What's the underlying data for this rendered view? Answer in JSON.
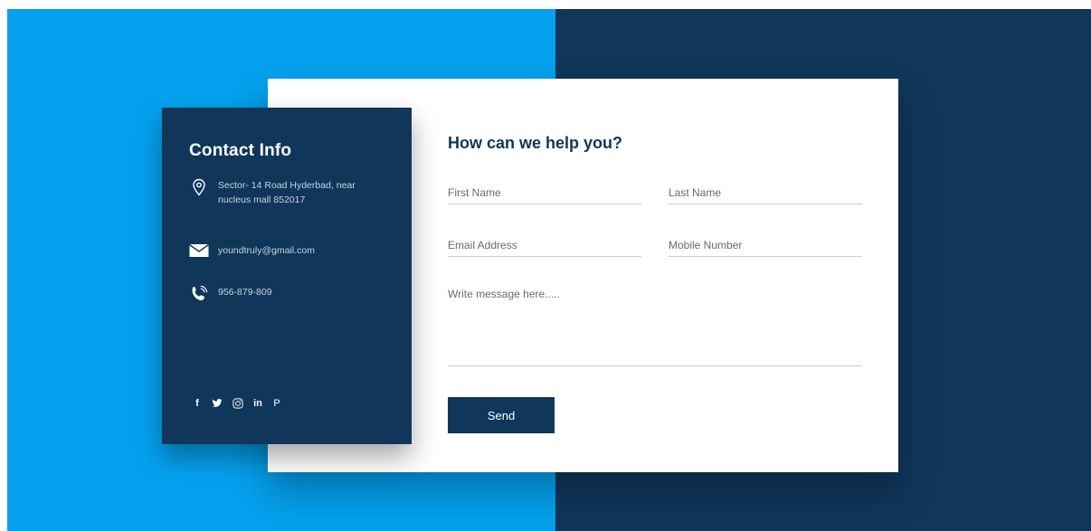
{
  "colors": {
    "accent_blue": "#05a1ee",
    "navy": "#10365a",
    "white": "#ffffff"
  },
  "contact_info": {
    "title": "Contact Info",
    "address": "Sector- 14 Road Hyderbad, near nucleus mall 852017",
    "email": "youndtruly@gmail.com",
    "phone": "956-879-809",
    "icons": [
      "location-icon",
      "mail-icon",
      "phone-icon"
    ],
    "social": {
      "facebook": "f",
      "twitter": "twitter-icon",
      "instagram": "instagram-icon",
      "linkedin": "in",
      "pinterest": "P"
    }
  },
  "form": {
    "title": "How can we help you?",
    "first_name_placeholder": "First Name",
    "last_name_placeholder": "Last Name",
    "email_placeholder": "Email Address",
    "mobile_placeholder": "Mobile Number",
    "message_placeholder": "Write message here.....",
    "send_label": "Send"
  }
}
